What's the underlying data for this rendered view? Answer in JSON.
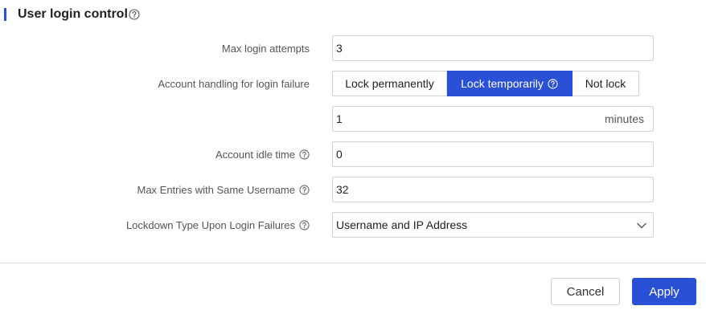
{
  "section": {
    "title": "User login control"
  },
  "fields": {
    "max_login_attempts": {
      "label": "Max login attempts",
      "value": "3"
    },
    "account_handling": {
      "label": "Account handling for login failure",
      "options": [
        "Lock permanently",
        "Lock temporarily",
        "Not lock"
      ],
      "selected": "Lock temporarily"
    },
    "lock_duration": {
      "value": "1",
      "unit": "minutes"
    },
    "account_idle_time": {
      "label": "Account idle time",
      "value": "0"
    },
    "max_entries_same_username": {
      "label": "Max Entries with Same Username",
      "value": "32"
    },
    "lockdown_type": {
      "label": "Lockdown Type Upon Login Failures",
      "value": "Username and IP Address"
    }
  },
  "buttons": {
    "cancel": "Cancel",
    "apply": "Apply"
  },
  "colors": {
    "accent": "#2a50d6"
  },
  "icons": {
    "help": "question-circle-icon",
    "dropdown": "chevron-down-icon"
  }
}
